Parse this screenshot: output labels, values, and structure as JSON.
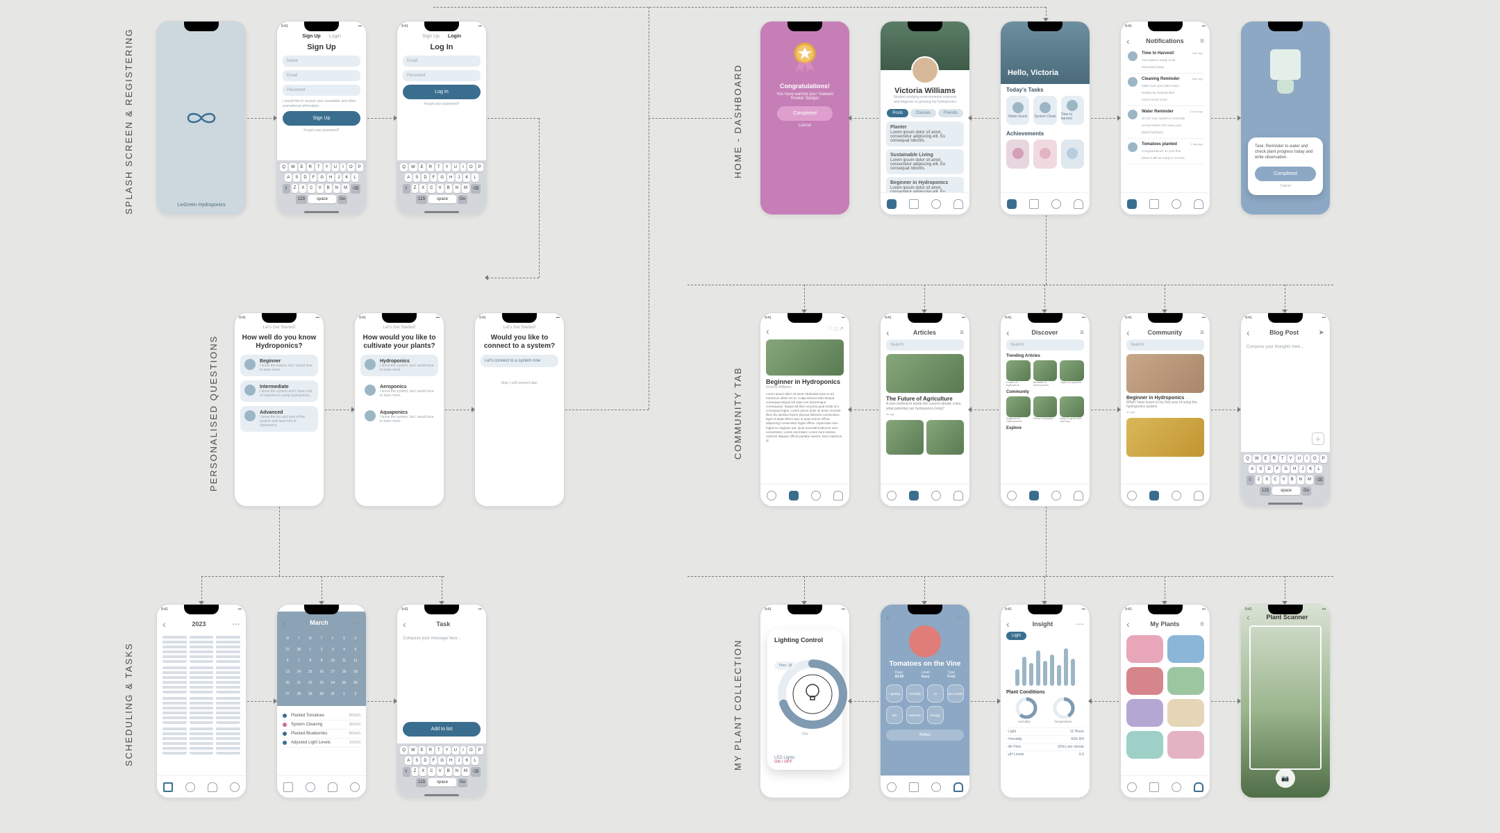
{
  "sections": {
    "splash": "SPLASH SCREEN & REGISTERING",
    "onboard": "PERSONALISED QUESTIONS",
    "schedule": "SCHEDULING & TASKS",
    "home": "HOME - DASHBOARD",
    "community": "COMMUNITY TAB",
    "plants": "MY PLANT COLLECTION"
  },
  "time": "9:41",
  "brand": "LivGreen Hydroponics",
  "signup": {
    "tab_signup": "Sign Up",
    "tab_login": "Login",
    "name": "Name",
    "email": "Email",
    "password": "Password",
    "terms": "I would like to receive your newsletter and other promotional information.",
    "button": "Sign Up",
    "forgot": "Forgot your password?"
  },
  "login": {
    "button": "Log In"
  },
  "keyboard": {
    "row1": [
      "Q",
      "W",
      "E",
      "R",
      "T",
      "Y",
      "U",
      "I",
      "O",
      "P"
    ],
    "row2": [
      "A",
      "S",
      "D",
      "F",
      "G",
      "H",
      "J",
      "K",
      "L"
    ],
    "row3": [
      "⇧",
      "Z",
      "X",
      "C",
      "V",
      "B",
      "N",
      "M",
      "⌫"
    ],
    "numkey": "123",
    "space": "space",
    "go": "Go"
  },
  "onboard_hint": "Let's Get Started!",
  "q1": {
    "title": "How well do you know Hydroponics?",
    "options": [
      {
        "name": "Beginner",
        "desc": "I know the basics, but I would love to learn more."
      },
      {
        "name": "Intermediate",
        "desc": "I know the system and I have a bit of experience using hydroponics."
      },
      {
        "name": "Advanced",
        "desc": "I know the ins and outs of the system and have lots of experience."
      }
    ]
  },
  "q2": {
    "title": "How would you like to cultivate your plants?",
    "options": [
      {
        "name": "Hydroponics",
        "desc": "I know the system, but I would love to learn more."
      },
      {
        "name": "Aeroponics",
        "desc": "I know the system, but I would love to learn more."
      },
      {
        "name": "Aquaponics",
        "desc": "I know the system, but I would love to learn more."
      }
    ]
  },
  "q3": {
    "title": "Would you like to connect to a system?",
    "connect": "Let's connect to a system now",
    "skip": "Skip, I will connect later"
  },
  "dashboard": {
    "badge_title": "Congratulations!",
    "badge_sub": "You have earned your 'Radiant Rookie' Badge!",
    "completed": "Completed",
    "cancel": "Cancel",
    "profile_name": "Victoria Williams",
    "profile_sub": "Student studying environmental sciences and beginner in growing my hydroponics",
    "tab_posts": "Posts",
    "tab_classes": "Classes",
    "tab_friends": "Friends",
    "posts": [
      {
        "title": "Planter",
        "body": "Lorem ipsum dolor sit amet, consectetur adipiscing elit. Eu consequat lobortis."
      },
      {
        "title": "Sustainable Living",
        "body": "Lorem ipsum dolor sit amet, consectetur adipiscing elit. Eu consequat lobortis."
      },
      {
        "title": "Beginner in Hydroponics",
        "body": "Lorem ipsum dolor sit amet, consectetur adipiscing elit. Eu consequat lobortis."
      }
    ],
    "hello": "Hello, Victoria",
    "todays": "Today's Tasks",
    "tasks": [
      "Water levels",
      "System Clean",
      "Time to harvest"
    ],
    "achievements": "Achievements",
    "notif_title": "Notifications",
    "notifs": [
      {
        "t": "Time to Harvest!",
        "d": "Your plant is ready to be harvested today",
        "time": "10m ago"
      },
      {
        "t": "Cleaning Reminder",
        "d": "Make sure your plant stays healthy by keeping their environment clean",
        "time": "30m ago"
      },
      {
        "t": "Water Reminder",
        "d": "Uh oh! Your system is currently on low levels, let's keep your plants hydrated",
        "time": "1 hour ago"
      },
      {
        "t": "Tomatoes planted",
        "d": "Congratulations on your first plant! It will be ready in no time.",
        "time": "1 day ago"
      }
    ],
    "reminder": "Task: Reminder to water and check plant progress today and write observation.",
    "reminder_btn": "Completed",
    "reminder_cancel": "Cancel"
  },
  "community": {
    "search": "Search",
    "article_title": "Beginner in Hydroponics",
    "article_author": "Victoria Williams",
    "article_body": "Lorem ipsum dolor sit amet. Molestiae ipsa ex ad maximum ullam vel ut. Culpa dolores tatio tempor consequat aliquid vel vitae eos doloremque consequatur. Eaque ad illum ea porta quia malla id a consequat fugiat. Lorem ipsum dolor sit amet. Eveniet illum illo ducibus facere placeat distinctio consectetur. Eget ut atque libero quis et quas earum officia adipiscing consectetur fugiat officia. Aspernatur eum fugiat ex magnam aut. Quia exercitant laborum vero consectetur. Lorem exercitant. Lorem sunt minima nostrum aliquam officiis pariatur viverra. Duis maximus id.",
    "articles_title": "Articles",
    "feature_title": "The Future of Agriculture",
    "feature_sub": "A new method to tackle the current climate crisis, what potential can hydroponics bring?",
    "feature_time": "6h ago",
    "discover_title": "Discover",
    "trending": "Trending Articles",
    "trending_items": [
      "Future of Agriculture",
      "Benefits of Hydroponics",
      "Types of systems"
    ],
    "community_title": "Community",
    "community_items": [
      "Beginner in Hydroponics",
      "Floral Collection",
      "Easy to grow fruit and veg"
    ],
    "explore": "Explore",
    "blog_title": "Blog Post",
    "blog_placeholder": "Compose your thoughts here...",
    "community_post_title": "Beginner in Hydroponics",
    "community_post_body": "What I have learnt in my first year of using the hydroponics system.",
    "community_post_time": "6h ago"
  },
  "schedule": {
    "year": "2023",
    "month": "March",
    "days": [
      "M",
      "T",
      "W",
      "T",
      "F",
      "S",
      "S"
    ],
    "dates": [
      27,
      28,
      1,
      2,
      3,
      4,
      5,
      6,
      7,
      8,
      9,
      10,
      11,
      12,
      13,
      14,
      15,
      16,
      17,
      18,
      19,
      20,
      21,
      22,
      23,
      24,
      25,
      26,
      27,
      28,
      29,
      30,
      31,
      1,
      2
    ],
    "events": [
      {
        "dot": "#3a6e8f",
        "name": "Planted Tomatoes",
        "time": "60min"
      },
      {
        "dot": "#c46e9a",
        "name": "System Cleaning",
        "time": "30min"
      },
      {
        "dot": "#3a6e8f",
        "name": "Planted Blueberries",
        "time": "60min"
      },
      {
        "dot": "#3a6e8f",
        "name": "Adjusted Light Levels",
        "time": "10min"
      }
    ],
    "task_title": "Task",
    "task_placeholder": "Compose your message here...",
    "task_button": "Add to list"
  },
  "plants": {
    "lighting_title": "Lighting Control",
    "time_label": "Time: 18",
    "percent": "70%",
    "led": "LED Lights",
    "led_state": "ON / OFF",
    "detail_title": "Tomatoes on the Vine",
    "stat_days": "Days",
    "stat_days_v": "60-80",
    "stat_level": "Level",
    "stat_level_v": "Easy",
    "stat_type": "Type",
    "stat_type_v": "Fruit",
    "cat": [
      "Lighting",
      "Humidity",
      "Air",
      "pH Levels",
      "QR",
      "Nutrients",
      "Energy"
    ],
    "notes": "Notes",
    "insight_title": "Insight",
    "insight_tab": "Light",
    "plant_conditions": "Plant Conditions",
    "gauge_hum": "Humidity",
    "gauge_temp": "Temperature",
    "rows": [
      {
        "k": "Light",
        "v": "12 Hours"
      },
      {
        "k": "Humidity",
        "v": "60% RH"
      },
      {
        "k": "Air Flow",
        "v": "100cc per minute"
      },
      {
        "k": "pH Levels",
        "v": "6.5"
      }
    ],
    "myplants": "My Plants",
    "scanner": "Plant Scanner"
  }
}
